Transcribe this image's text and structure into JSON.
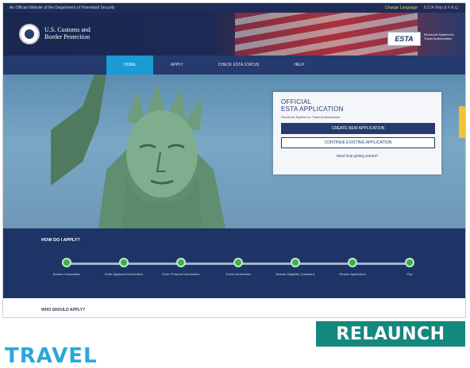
{
  "topbar": {
    "left": "An Official Website of the Department of Homeland Security",
    "right1": "Change Language",
    "right2": "ESTA Help & F.A.Q."
  },
  "header": {
    "agency_line1": "U.S. Customs and",
    "agency_line2": "Border Protection",
    "esta_logo": "ESTA",
    "esta_subtitle": "Electronic System for Travel Authorization"
  },
  "nav": {
    "items": [
      "HOME",
      "APPLY",
      "CHECK ESTA STATUS",
      "HELP"
    ]
  },
  "card": {
    "title_line1": "OFFICIAL",
    "title_line2": "ESTA APPLICATION",
    "subtitle": "Electronic System for Travel Authorization",
    "create_button": "CREATE NEW APPLICATION",
    "continue_button": "CONTINUE EXISTING APPLICATION",
    "help_link": "Need help getting started?"
  },
  "steps": {
    "heading": "HOW DO I APPLY?",
    "labels": [
      "Answer Information",
      "Enter Applicant Information",
      "Enter Personal Information",
      "Travel Information",
      "Answer Eligibility Questions",
      "Review Application",
      "Pay"
    ]
  },
  "who": {
    "heading": "WHO SHOULD APPLY?"
  },
  "overlay": {
    "relaunch": "RELAUNCH",
    "travel": "TRAVEL"
  },
  "colors": {
    "navy": "#253a6e",
    "accent": "#1a9bd6",
    "step_green": "#3ab24a",
    "relaunch_teal": "#14877e",
    "travel_blue": "#2aa8d9"
  }
}
